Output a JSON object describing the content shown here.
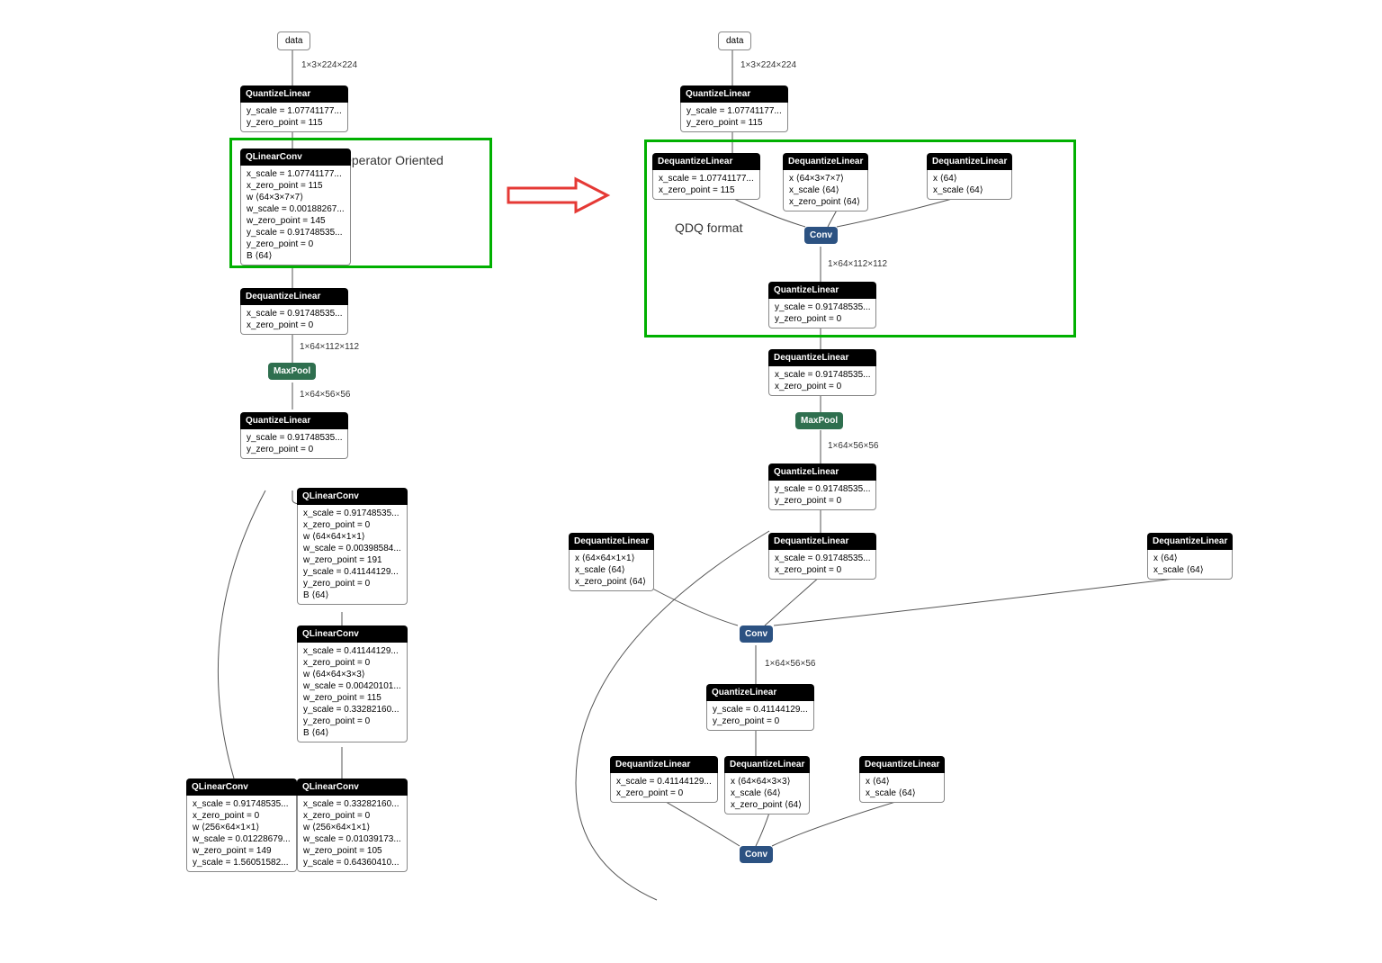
{
  "annotations": {
    "left_label": "Operator Oriented",
    "right_label": "QDQ format"
  },
  "left": {
    "input": {
      "label": "data"
    },
    "edge_input": "1×3×224×224",
    "quantize1": {
      "title": "QuantizeLinear",
      "attrs": [
        "y_scale = 1.07741177...",
        "y_zero_point = 115"
      ]
    },
    "qlinearconv1": {
      "title": "QLinearConv",
      "attrs": [
        "x_scale = 1.07741177...",
        "x_zero_point = 115",
        "w ⟨64×3×7×7⟩",
        "w_scale = 0.00188267...",
        "w_zero_point = 145",
        "y_scale = 0.91748535...",
        "y_zero_point = 0",
        "B ⟨64⟩"
      ]
    },
    "dequant1": {
      "title": "DequantizeLinear",
      "attrs": [
        "x_scale = 0.91748535...",
        "x_zero_point = 0"
      ]
    },
    "edge_dq1": "1×64×112×112",
    "maxpool": {
      "title": "MaxPool"
    },
    "edge_mp": "1×64×56×56",
    "quantize2": {
      "title": "QuantizeLinear",
      "attrs": [
        "y_scale = 0.91748535...",
        "y_zero_point = 0"
      ]
    },
    "qlinearconv2": {
      "title": "QLinearConv",
      "attrs": [
        "x_scale = 0.91748535...",
        "x_zero_point = 0",
        "w ⟨64×64×1×1⟩",
        "w_scale = 0.00398584...",
        "w_zero_point = 191",
        "y_scale = 0.41144129...",
        "y_zero_point = 0",
        "B ⟨64⟩"
      ]
    },
    "qlinearconv3": {
      "title": "QLinearConv",
      "attrs": [
        "x_scale = 0.41144129...",
        "x_zero_point = 0",
        "w ⟨64×64×3×3⟩",
        "w_scale = 0.00420101...",
        "w_zero_point = 115",
        "y_scale = 0.33282160...",
        "y_zero_point = 0",
        "B ⟨64⟩"
      ]
    },
    "qlinearconv4": {
      "title": "QLinearConv",
      "attrs": [
        "x_scale = 0.91748535...",
        "x_zero_point = 0",
        "w ⟨256×64×1×1⟩",
        "w_scale = 0.01228679...",
        "w_zero_point = 149",
        "y_scale = 1.56051582..."
      ]
    },
    "qlinearconv5": {
      "title": "QLinearConv",
      "attrs": [
        "x_scale = 0.33282160...",
        "x_zero_point = 0",
        "w ⟨256×64×1×1⟩",
        "w_scale = 0.01039173...",
        "w_zero_point = 105",
        "y_scale = 0.64360410..."
      ]
    }
  },
  "right": {
    "input": {
      "label": "data"
    },
    "edge_input": "1×3×224×224",
    "quantize1": {
      "title": "QuantizeLinear",
      "attrs": [
        "y_scale = 1.07741177...",
        "y_zero_point = 115"
      ]
    },
    "dq_a": {
      "title": "DequantizeLinear",
      "attrs": [
        "x_scale = 1.07741177...",
        "x_zero_point = 115"
      ]
    },
    "dq_b": {
      "title": "DequantizeLinear",
      "attrs": [
        "x ⟨64×3×7×7⟩",
        "x_scale ⟨64⟩",
        "x_zero_point ⟨64⟩"
      ]
    },
    "dq_c": {
      "title": "DequantizeLinear",
      "attrs": [
        "x ⟨64⟩",
        "x_scale ⟨64⟩"
      ]
    },
    "conv1": {
      "title": "Conv"
    },
    "edge_conv1": "1×64×112×112",
    "quantize2": {
      "title": "QuantizeLinear",
      "attrs": [
        "y_scale = 0.91748535...",
        "y_zero_point = 0"
      ]
    },
    "dequant2": {
      "title": "DequantizeLinear",
      "attrs": [
        "x_scale = 0.91748535...",
        "x_zero_point = 0"
      ]
    },
    "maxpool": {
      "title": "MaxPool"
    },
    "edge_mp": "1×64×56×56",
    "quantize3": {
      "title": "QuantizeLinear",
      "attrs": [
        "y_scale = 0.91748535...",
        "y_zero_point = 0"
      ]
    },
    "dq_d": {
      "title": "DequantizeLinear",
      "attrs": [
        "x ⟨64×64×1×1⟩",
        "x_scale ⟨64⟩",
        "x_zero_point ⟨64⟩"
      ]
    },
    "dq_e": {
      "title": "DequantizeLinear",
      "attrs": [
        "x_scale = 0.91748535...",
        "x_zero_point = 0"
      ]
    },
    "dq_f": {
      "title": "DequantizeLinear",
      "attrs": [
        "x ⟨64⟩",
        "x_scale ⟨64⟩"
      ]
    },
    "conv2": {
      "title": "Conv"
    },
    "edge_conv2": "1×64×56×56",
    "quantize4": {
      "title": "QuantizeLinear",
      "attrs": [
        "y_scale = 0.41144129...",
        "y_zero_point = 0"
      ]
    },
    "dq_g": {
      "title": "DequantizeLinear",
      "attrs": [
        "x_scale = 0.41144129...",
        "x_zero_point = 0"
      ]
    },
    "dq_h": {
      "title": "DequantizeLinear",
      "attrs": [
        "x ⟨64×64×3×3⟩",
        "x_scale ⟨64⟩",
        "x_zero_point ⟨64⟩"
      ]
    },
    "dq_i": {
      "title": "DequantizeLinear",
      "attrs": [
        "x ⟨64⟩",
        "x_scale ⟨64⟩"
      ]
    },
    "conv3": {
      "title": "Conv"
    }
  }
}
